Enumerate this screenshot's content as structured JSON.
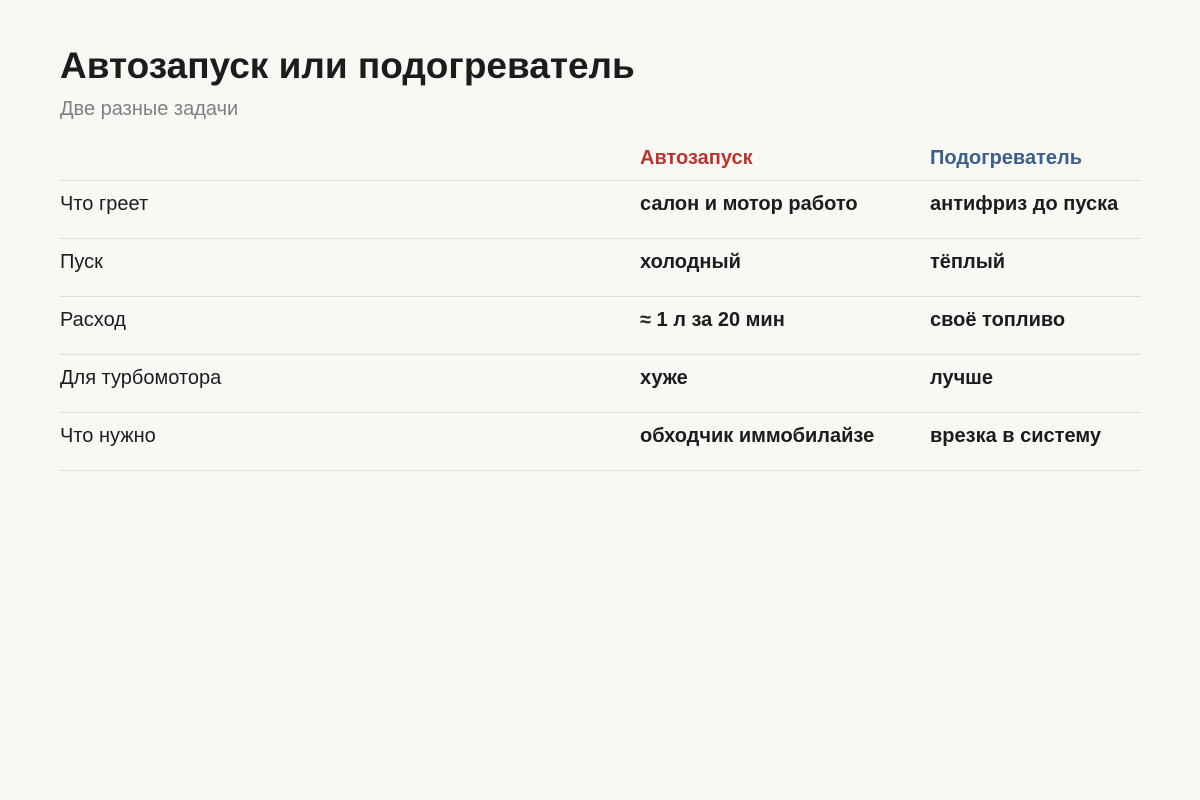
{
  "header": {
    "title": "Автозапуск или подогреватель",
    "subtitle": "Две разные задачи"
  },
  "table": {
    "columns": [
      "",
      "Автозапуск",
      "Подогреватель"
    ],
    "column_colors": {
      "autostart": "#b5372f",
      "heater": "#3d5f8a"
    },
    "rows": [
      [
        "Что греет",
        "салон и мотор работо",
        "антифриз до пуска"
      ],
      [
        "Пуск",
        "холодный",
        "тёплый"
      ],
      [
        "Расход",
        "≈ 1 л за 20 мин",
        "своё топливо"
      ],
      [
        "Для турбомотора",
        "хуже",
        "лучше"
      ],
      [
        "Что нужно",
        "обходчик иммобилайзе",
        "врезка в систему"
      ]
    ]
  }
}
